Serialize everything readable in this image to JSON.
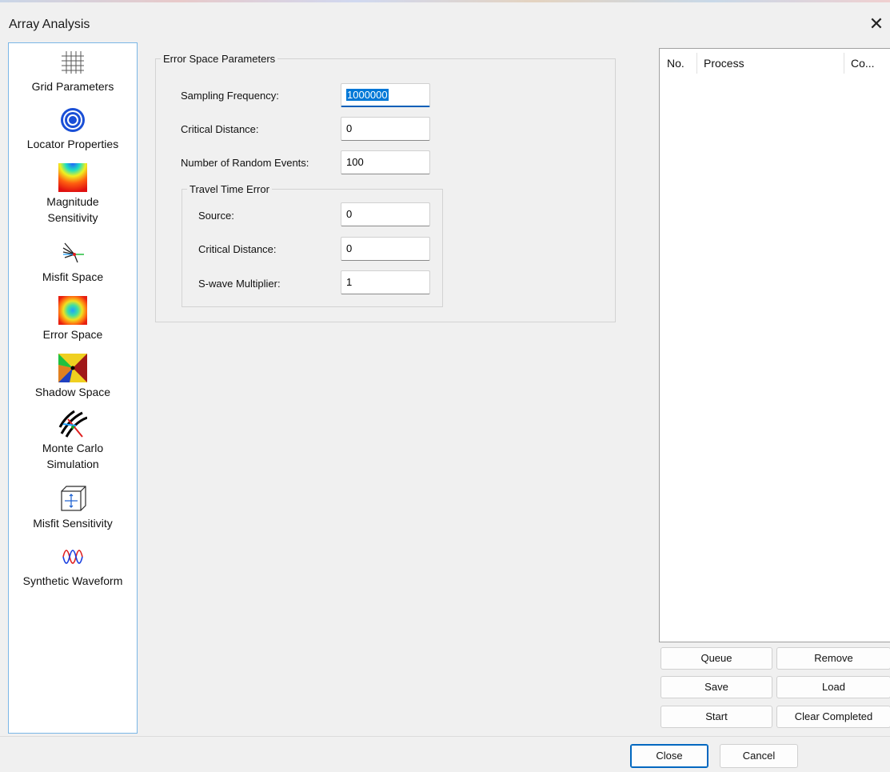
{
  "window": {
    "title": "Array Analysis",
    "close_glyph": "✕"
  },
  "nav": [
    {
      "label": "Grid Parameters",
      "icon": "grid-icon"
    },
    {
      "label": "Locator Properties",
      "icon": "target-icon"
    },
    {
      "label": "Magnitude\nSensitivity",
      "icon": "magnitude-heatmap-icon"
    },
    {
      "label": "Misfit Space",
      "icon": "misfit-rays-icon"
    },
    {
      "label": "Error Space",
      "icon": "error-space-icon"
    },
    {
      "label": "Shadow Space",
      "icon": "shadow-space-icon"
    },
    {
      "label": "Monte Carlo\nSimulation",
      "icon": "monte-carlo-icon"
    },
    {
      "label": "Misfit Sensitivity",
      "icon": "cube-icon"
    },
    {
      "label": "Synthetic Waveform",
      "icon": "waveform-icon"
    }
  ],
  "error_space": {
    "legend": "Error Space Parameters",
    "sampling_frequency": {
      "label": "Sampling Frequency:",
      "value": "1000000"
    },
    "critical_distance": {
      "label": "Critical Distance:",
      "value": "0"
    },
    "random_events": {
      "label": "Number of Random Events:",
      "value": "100"
    }
  },
  "travel_time": {
    "legend": "Travel Time Error",
    "source": {
      "label": "Source:",
      "value": "0"
    },
    "critical_distance": {
      "label": "Critical Distance:",
      "value": "0"
    },
    "s_wave": {
      "label": "S-wave Multiplier:",
      "value": "1"
    }
  },
  "process_list": {
    "columns": [
      "No.",
      "Process",
      "Co..."
    ]
  },
  "process_buttons": {
    "queue": "Queue",
    "remove": "Remove",
    "save": "Save",
    "load": "Load",
    "start": "Start",
    "clear": "Clear Completed"
  },
  "footer": {
    "close": "Close",
    "cancel": "Cancel"
  }
}
